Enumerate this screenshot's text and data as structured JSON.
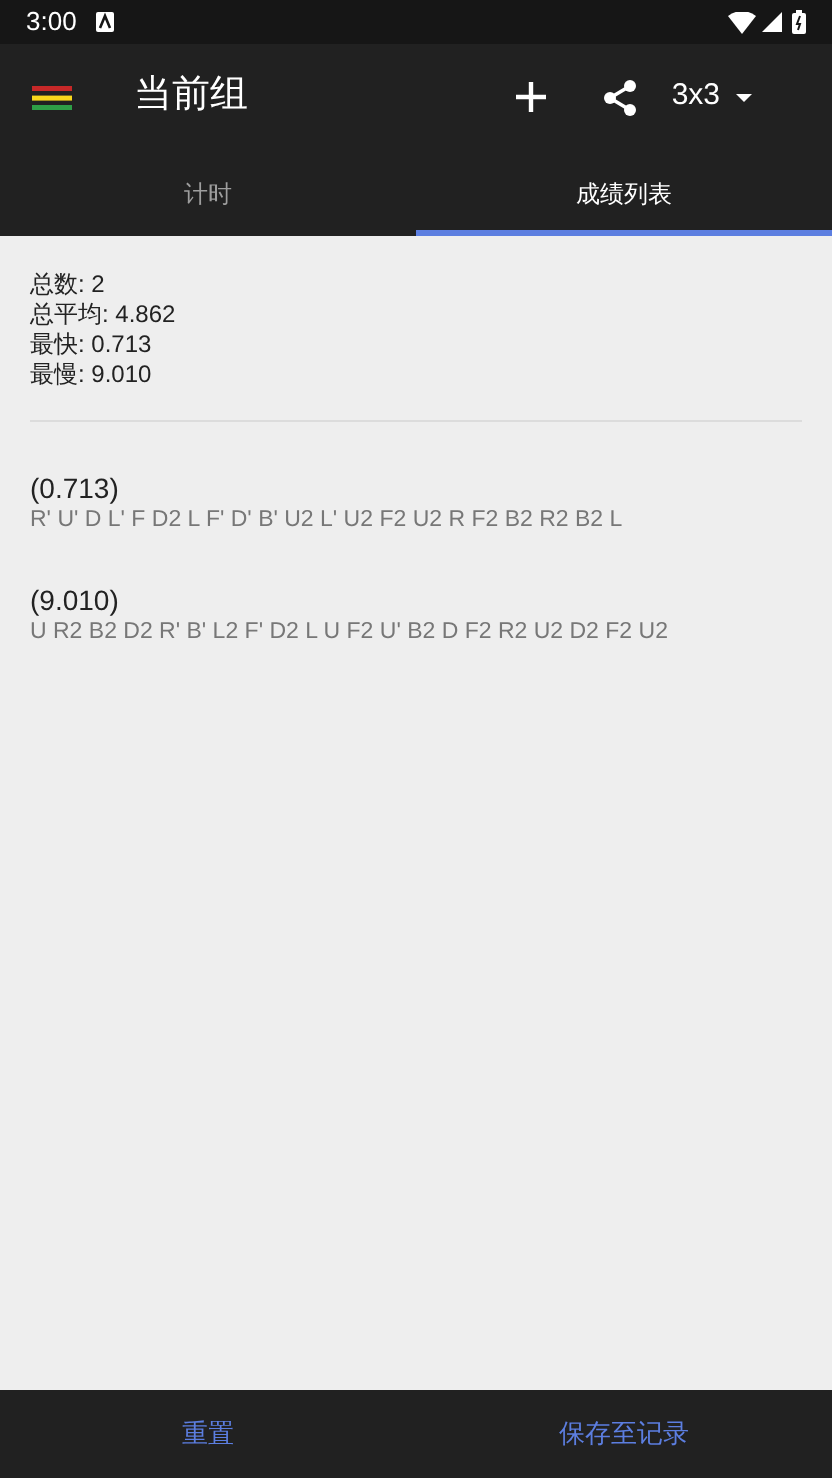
{
  "status_bar": {
    "time": "3:00"
  },
  "app_bar": {
    "title": "当前组",
    "puzzle": "3x3"
  },
  "tabs": [
    {
      "label": "计时",
      "selected": false
    },
    {
      "label": "成绩列表",
      "selected": true
    }
  ],
  "stats": [
    "总数: 2",
    "总平均: 4.862",
    "最快: 0.713",
    "最慢: 9.010"
  ],
  "results": [
    {
      "time": "(0.713)",
      "scramble": "R' U' D L' F D2 L F' D' B' U2 L' U2 F2 U2 R F2 B2 R2 B2 L"
    },
    {
      "time": "(9.010)",
      "scramble": "U R2 B2 D2 R' B' L2 F' D2 L U F2 U' B2 D F2 R2 U2 D2 F2 U2"
    }
  ],
  "buttons": [
    "重置",
    "保存至记录"
  ]
}
